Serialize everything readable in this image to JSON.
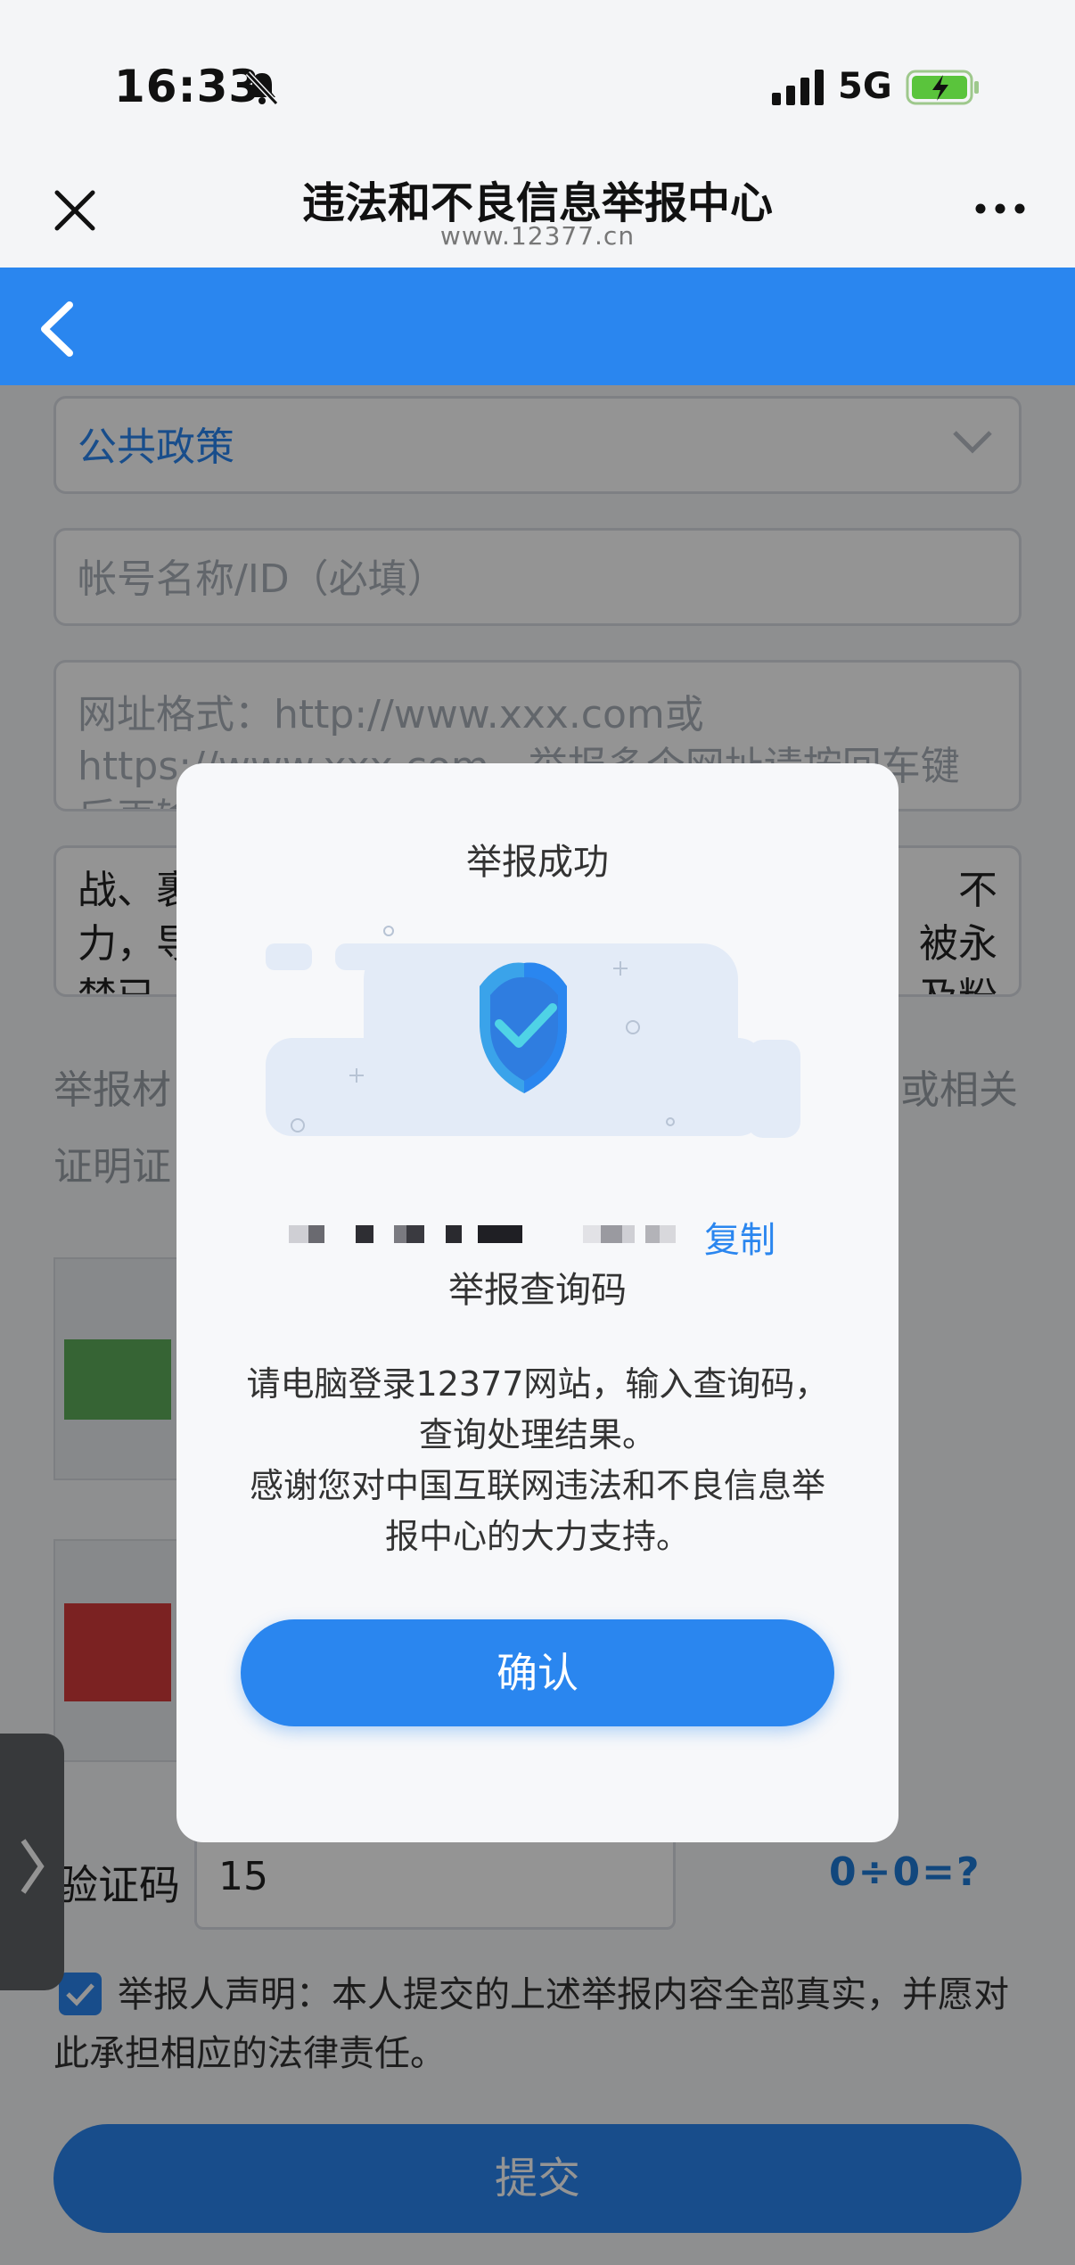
{
  "status_bar": {
    "time": "16:33",
    "network": "5G"
  },
  "titlebar": {
    "title": "违法和不良信息举报中心",
    "url": "www.12377.cn"
  },
  "form": {
    "category_value": "公共政策",
    "account_placeholder": "帐号名称/ID（必填）",
    "url_placeholder_line1": "网址格式：http://www.xxx.com或",
    "url_placeholder_line2": "https://www.xxx.com，举报多个网址请按回车键",
    "url_placeholder_line3": "后再输",
    "desc_line1": "战、裹",
    "desc_line1_right": "不",
    "desc_line2": "力，导",
    "desc_line2_right": "被永",
    "desc_line3": "禁已…",
    "desc_line3_right": "及粉",
    "evidence_label_left": "举报材",
    "evidence_label_right": "或相关",
    "evidence_label_line2": "证明证",
    "captcha_label": "验证码",
    "captcha_value": "15",
    "captcha_image_text": "0÷0=?",
    "declaration": "举报人声明：本人提交的上述举报内容全部真实，并愿对此承担相应的法律责任。",
    "submit_label": "提交"
  },
  "modal": {
    "title": "举报成功",
    "copy_label": "复制",
    "code_label": "举报查询码",
    "message_line1": "请电脑登录12377网站，输入查询码，",
    "message_line2": "查询处理结果。",
    "message_line3": "感谢您对中国互联网违法和不良信息举",
    "message_line4": "报中心的大力支持。",
    "confirm_label": "确认"
  },
  "colors": {
    "primary": "#2a86ef",
    "overlay": "rgba(0,0,0,0.42)"
  }
}
